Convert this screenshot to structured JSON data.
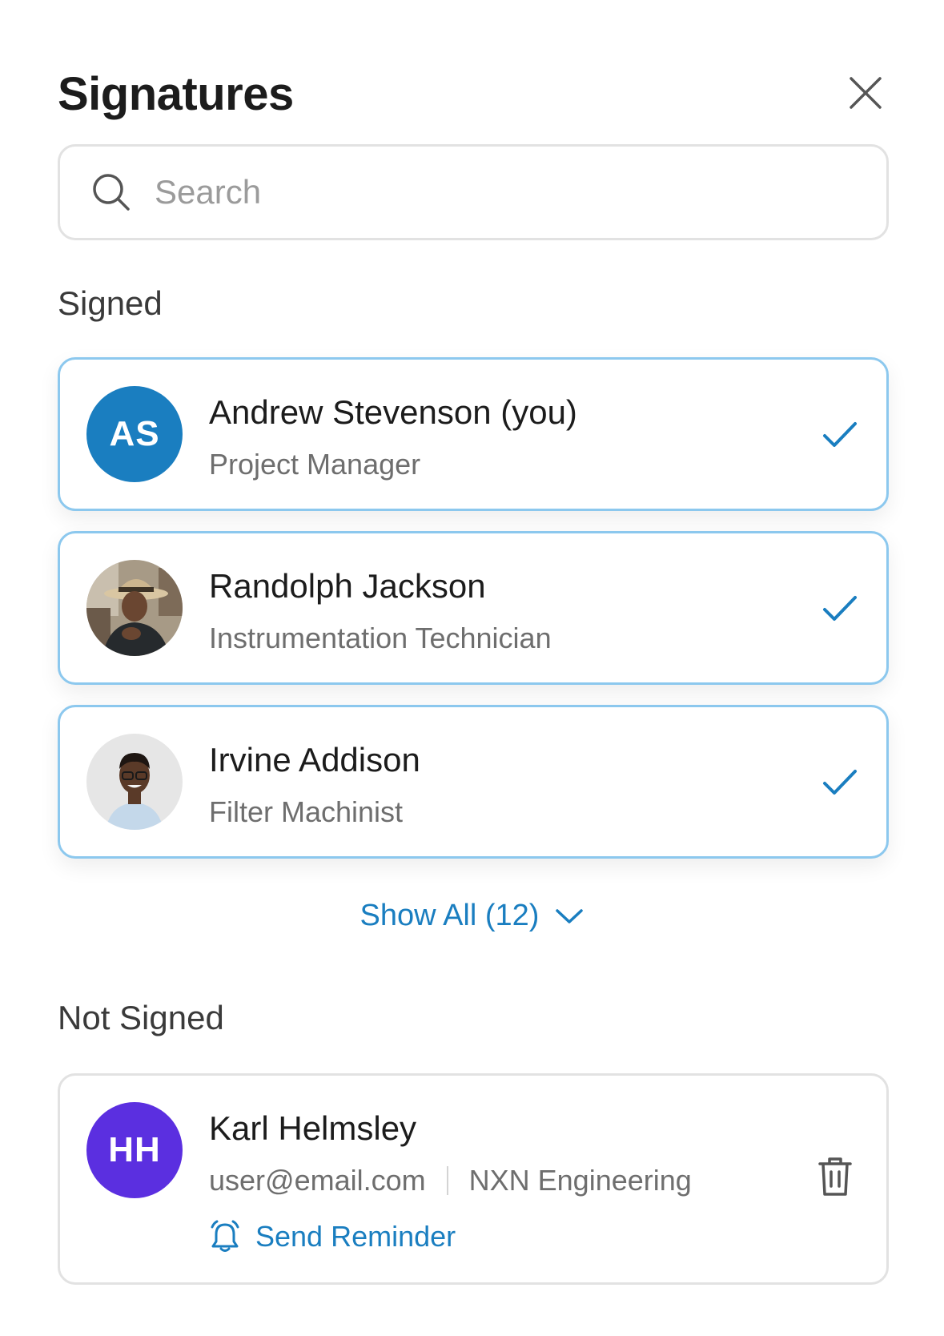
{
  "header": {
    "title": "Signatures",
    "close_icon": "close-icon"
  },
  "search": {
    "placeholder": "Search",
    "value": ""
  },
  "sections": {
    "signed": "Signed",
    "not_signed": "Not Signed"
  },
  "signed_items": [
    {
      "name": "Andrew Stevenson (you)",
      "role": "Project Manager",
      "initials": "AS",
      "avatar_color": "#1a7ec0",
      "status_icon": "check-icon"
    },
    {
      "name": "Randolph Jackson",
      "role": "Instrumentation Technician",
      "avatar": "photo",
      "status_icon": "check-icon"
    },
    {
      "name": "Irvine Addison",
      "role": "Filter Machinist",
      "avatar": "photo",
      "status_icon": "check-icon"
    }
  ],
  "show_all": {
    "label": "Show All (12)",
    "icon": "chevron-down-icon"
  },
  "not_signed_items": [
    {
      "name": "Karl Helmsley",
      "initials": "HH",
      "avatar_color": "#5b2fe0",
      "email": "user@email.com",
      "company": "NXN Engineering",
      "reminder_label": "Send Reminder",
      "reminder_icon": "bell-icon",
      "delete_icon": "trash-icon"
    }
  ],
  "colors": {
    "accent": "#1a7ec0",
    "signed_border": "#8cc8ee",
    "neutral_border": "#e2e2e2"
  }
}
